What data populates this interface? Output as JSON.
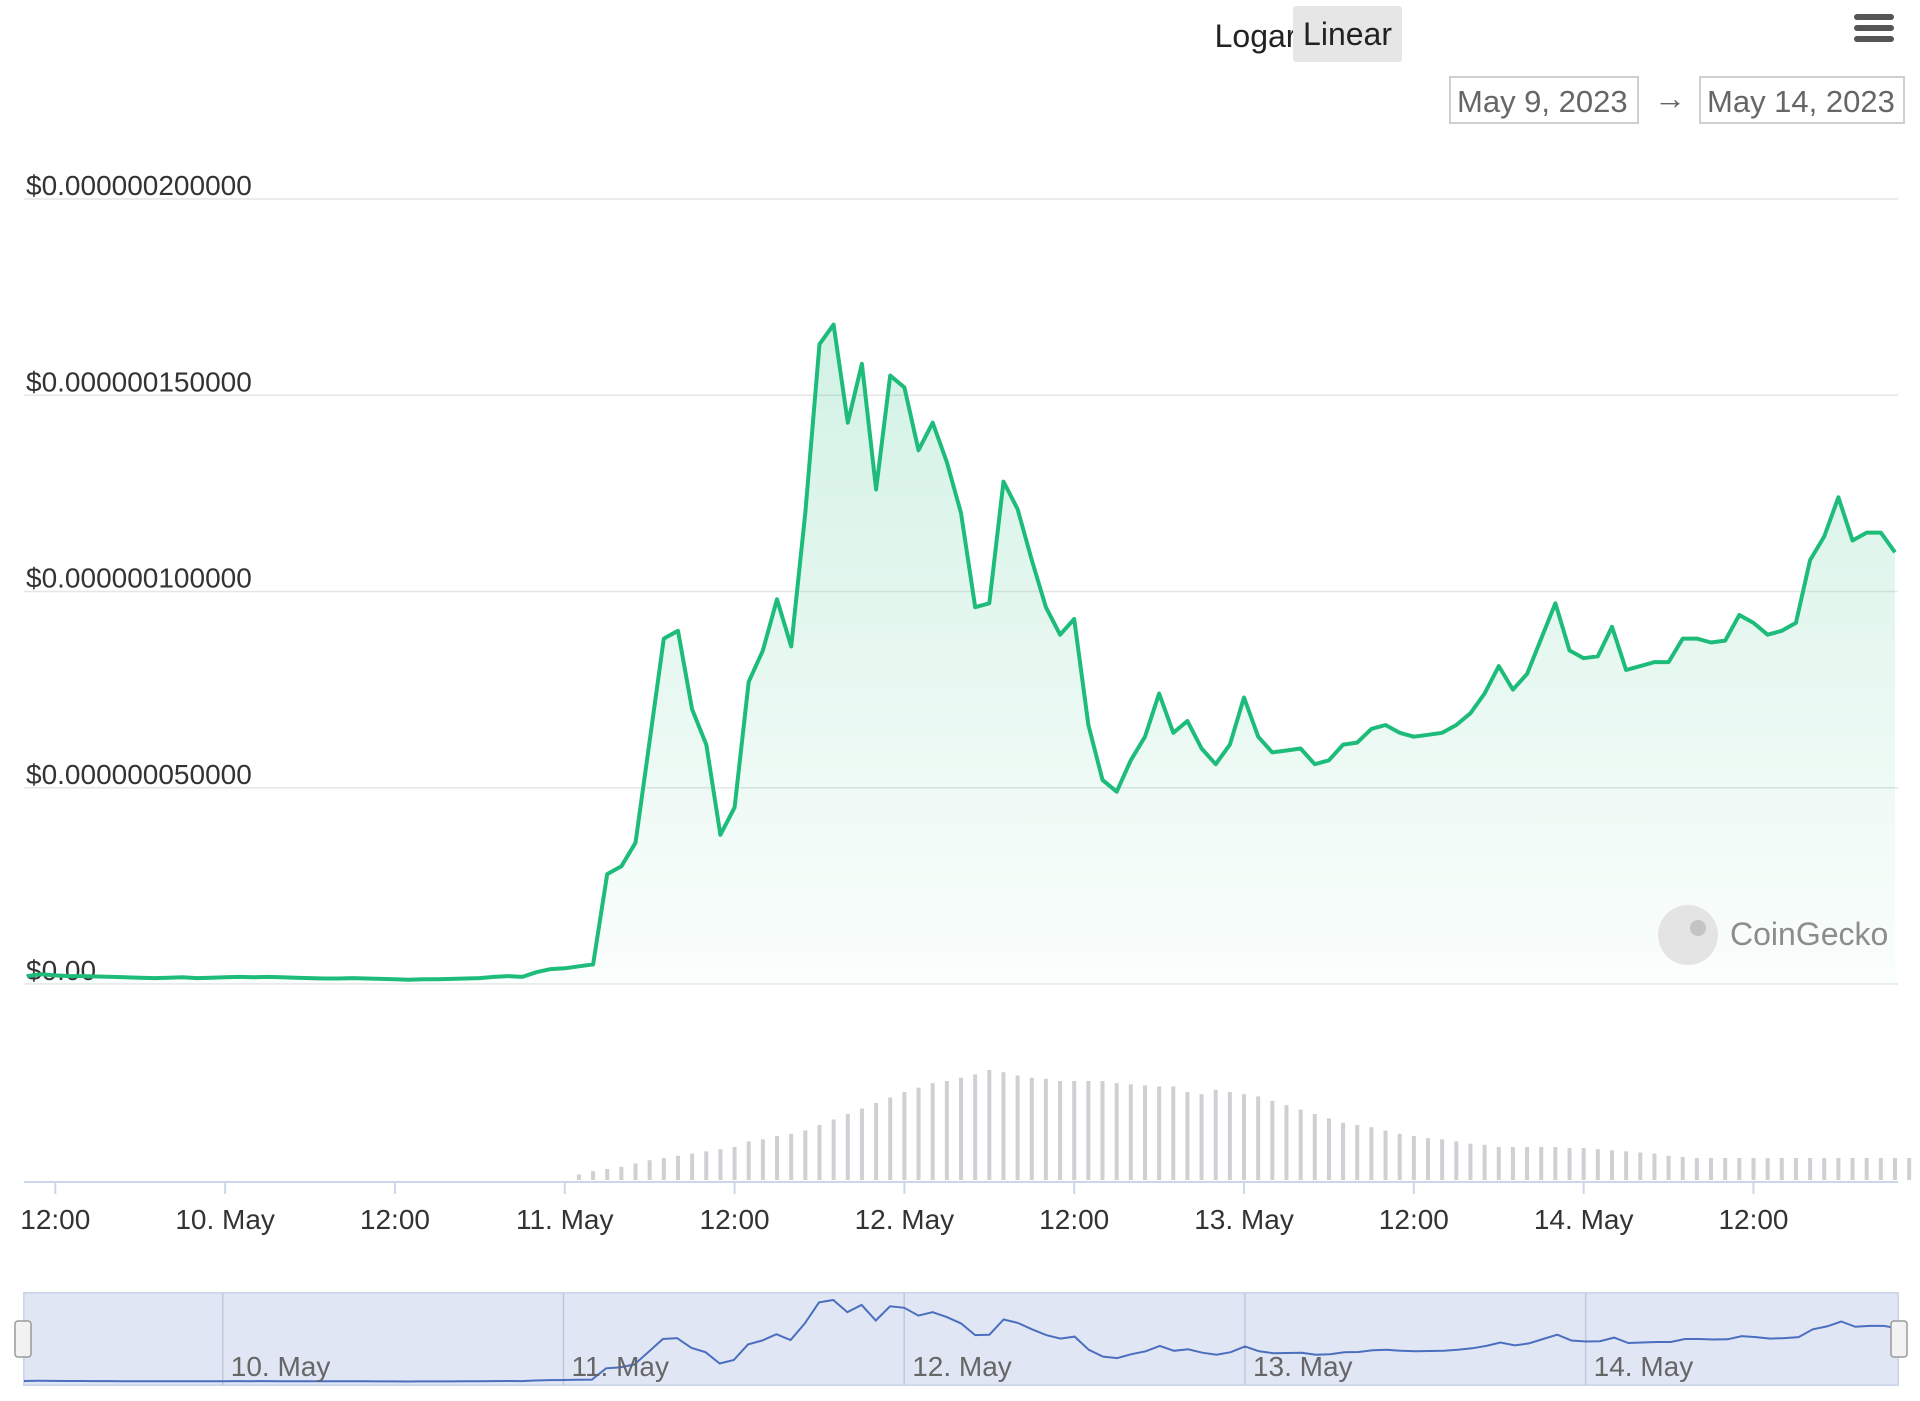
{
  "controls": {
    "log_label": "Logarithmic",
    "linear_label": "Linear",
    "date_from": "May 9, 2023",
    "date_arrow": "→",
    "date_to": "May 14, 2023"
  },
  "watermark": "CoinGecko",
  "colors": {
    "line": "#1ebc7a",
    "volume": "#cfcfd4",
    "navigator_line": "#4a6fbf",
    "navigator_fill": "#d4dbf0"
  },
  "chart_data": {
    "type": "area",
    "title": "",
    "xlabel": "",
    "ylabel": "",
    "scale": "linear",
    "grid": true,
    "x_start": "2023-05-09T10:00",
    "x_step_hours": 1,
    "ylim": [
      0,
      2e-07
    ],
    "y_ticks": [
      {
        "value": 0,
        "label": "$0.00"
      },
      {
        "value": 5e-08,
        "label": "$0.000000050000"
      },
      {
        "value": 1e-07,
        "label": "$0.000000100000"
      },
      {
        "value": 1.5e-07,
        "label": "$0.000000150000"
      },
      {
        "value": 2e-07,
        "label": "$0.000000200000"
      }
    ],
    "x_ticks": [
      {
        "x": "2023-05-09T12:00",
        "label": "12:00"
      },
      {
        "x": "2023-05-10T00:00",
        "label": "10. May"
      },
      {
        "x": "2023-05-10T12:00",
        "label": "12:00"
      },
      {
        "x": "2023-05-11T00:00",
        "label": "11. May"
      },
      {
        "x": "2023-05-11T12:00",
        "label": "12:00"
      },
      {
        "x": "2023-05-12T00:00",
        "label": "12. May"
      },
      {
        "x": "2023-05-12T12:00",
        "label": "12:00"
      },
      {
        "x": "2023-05-13T00:00",
        "label": "13. May"
      },
      {
        "x": "2023-05-13T12:00",
        "label": "12:00"
      },
      {
        "x": "2023-05-14T00:00",
        "label": "14. May"
      },
      {
        "x": "2023-05-14T12:00",
        "label": "12:00"
      }
    ],
    "navigator_labels": [
      "10. May",
      "11. May",
      "12. May",
      "13. May",
      "14. May"
    ],
    "series": [
      {
        "values": [
          2e-09,
          2.5e-09,
          2.2e-09,
          2e-09,
          2e-09,
          1.9e-09,
          1.8e-09,
          1.7e-09,
          1.6e-09,
          1.5e-09,
          1.6e-09,
          1.7e-09,
          1.5e-09,
          1.6e-09,
          1.7e-09,
          1.8e-09,
          1.7e-09,
          1.8e-09,
          1.7e-09,
          1.6e-09,
          1.5e-09,
          1.4e-09,
          1.4e-09,
          1.5e-09,
          1.4e-09,
          1.3e-09,
          1.2e-09,
          1.1e-09,
          1.2e-09,
          1.2e-09,
          1.3e-09,
          1.4e-09,
          1.5e-09,
          1.8e-09,
          2e-09,
          1.8e-09,
          3e-09,
          3.8e-09,
          4e-09,
          4.5e-09,
          5e-09,
          2.8e-08,
          3e-08,
          3.6e-08,
          6.2e-08,
          8.8e-08,
          9e-08,
          7e-08,
          6.1e-08,
          3.8e-08,
          4.5e-08,
          7.7e-08,
          8.5e-08,
          9.8e-08,
          8.6e-08,
          1.2e-07,
          1.63e-07,
          1.68e-07,
          1.43e-07,
          1.58e-07,
          1.26e-07,
          1.55e-07,
          1.52e-07,
          1.36e-07,
          1.43e-07,
          1.33e-07,
          1.2e-07,
          9.6e-08,
          9.7e-08,
          1.28e-07,
          1.21e-07,
          1.08e-07,
          9.6e-08,
          8.9e-08,
          9.3e-08,
          6.6e-08,
          5.2e-08,
          4.9e-08,
          5.7e-08,
          6.3e-08,
          7.4e-08,
          6.4e-08,
          6.7e-08,
          6e-08,
          5.6e-08,
          6.1e-08,
          7.3e-08,
          6.3e-08,
          5.9e-08,
          5.95e-08,
          6e-08,
          5.6e-08,
          5.7e-08,
          6.1e-08,
          6.15e-08,
          6.5e-08,
          6.6e-08,
          6.4e-08,
          6.3e-08,
          6.35e-08,
          6.4e-08,
          6.6e-08,
          6.9e-08,
          7.4e-08,
          8.1e-08,
          7.5e-08,
          7.9e-08,
          8.8e-08,
          9.7e-08,
          8.5e-08,
          8.3e-08,
          8.35e-08,
          9.1e-08,
          8e-08,
          8.1e-08,
          8.2e-08,
          8.2e-08,
          8.8e-08,
          8.8e-08,
          8.7e-08,
          8.75e-08,
          9.4e-08,
          9.2e-08,
          8.9e-08,
          9e-08,
          9.2e-08,
          1.08e-07,
          1.14e-07,
          1.24e-07,
          1.13e-07,
          1.15e-07,
          1.15e-07,
          1.1e-07
        ]
      }
    ],
    "volume_relative": [
      0,
      0,
      0,
      0,
      0,
      0,
      0,
      0,
      0,
      0,
      0,
      0,
      0,
      0,
      0,
      0,
      0,
      0,
      0,
      0,
      0,
      0,
      0,
      0,
      0,
      0,
      0,
      0,
      0,
      0,
      0,
      0,
      0,
      0,
      0,
      0,
      0,
      0,
      0,
      0.05,
      0.08,
      0.1,
      0.12,
      0.15,
      0.18,
      0.2,
      0.22,
      0.24,
      0.26,
      0.28,
      0.3,
      0.35,
      0.37,
      0.4,
      0.42,
      0.45,
      0.5,
      0.55,
      0.6,
      0.65,
      0.7,
      0.75,
      0.8,
      0.84,
      0.88,
      0.9,
      0.93,
      0.96,
      1.0,
      0.98,
      0.95,
      0.93,
      0.92,
      0.9,
      0.9,
      0.9,
      0.9,
      0.88,
      0.87,
      0.86,
      0.85,
      0.85,
      0.8,
      0.78,
      0.82,
      0.8,
      0.78,
      0.76,
      0.72,
      0.68,
      0.64,
      0.6,
      0.56,
      0.52,
      0.5,
      0.48,
      0.45,
      0.42,
      0.4,
      0.38,
      0.37,
      0.35,
      0.33,
      0.32,
      0.3,
      0.3,
      0.3,
      0.3,
      0.3,
      0.29,
      0.29,
      0.28,
      0.27,
      0.26,
      0.25,
      0.24,
      0.22,
      0.21,
      0.2,
      0.2,
      0.2,
      0.2,
      0.2,
      0.2,
      0.2,
      0.2,
      0.2,
      0.2,
      0.2,
      0.2,
      0.2,
      0.2,
      0.2,
      0.2,
      0.2,
      0.2,
      0.2,
      0.2,
      0.2,
      0.21,
      0.22,
      0.22,
      0.22,
      0.22,
      0.22,
      0.21
    ]
  }
}
